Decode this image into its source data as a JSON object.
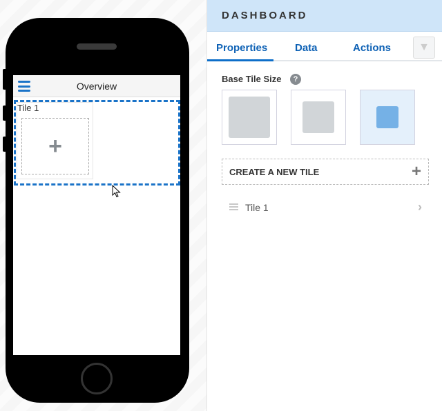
{
  "phone": {
    "screen_title": "Overview",
    "tile_label": "Tile 1",
    "add_icon": "plus-icon",
    "menu_icon": "hamburger-icon"
  },
  "panel": {
    "title": "DASHBOARD",
    "tabs": [
      {
        "label": "Properties",
        "active": true
      },
      {
        "label": "Data"
      },
      {
        "label": "Actions"
      }
    ],
    "tab_icon": "collapse-panel-icon",
    "base_tile_size_label": "Base Tile Size",
    "help_glyph": "?",
    "tile_sizes": [
      {
        "name": "large"
      },
      {
        "name": "medium"
      },
      {
        "name": "small",
        "selected": true
      }
    ],
    "create_label": "CREATE A NEW TILE",
    "create_glyph": "+",
    "tiles": [
      {
        "label": "Tile 1"
      }
    ],
    "chevron": "›"
  },
  "colors": {
    "accent": "#0d6ec9",
    "header_bg": "#cfe5f9",
    "selected_tile": "#75b1e6"
  }
}
